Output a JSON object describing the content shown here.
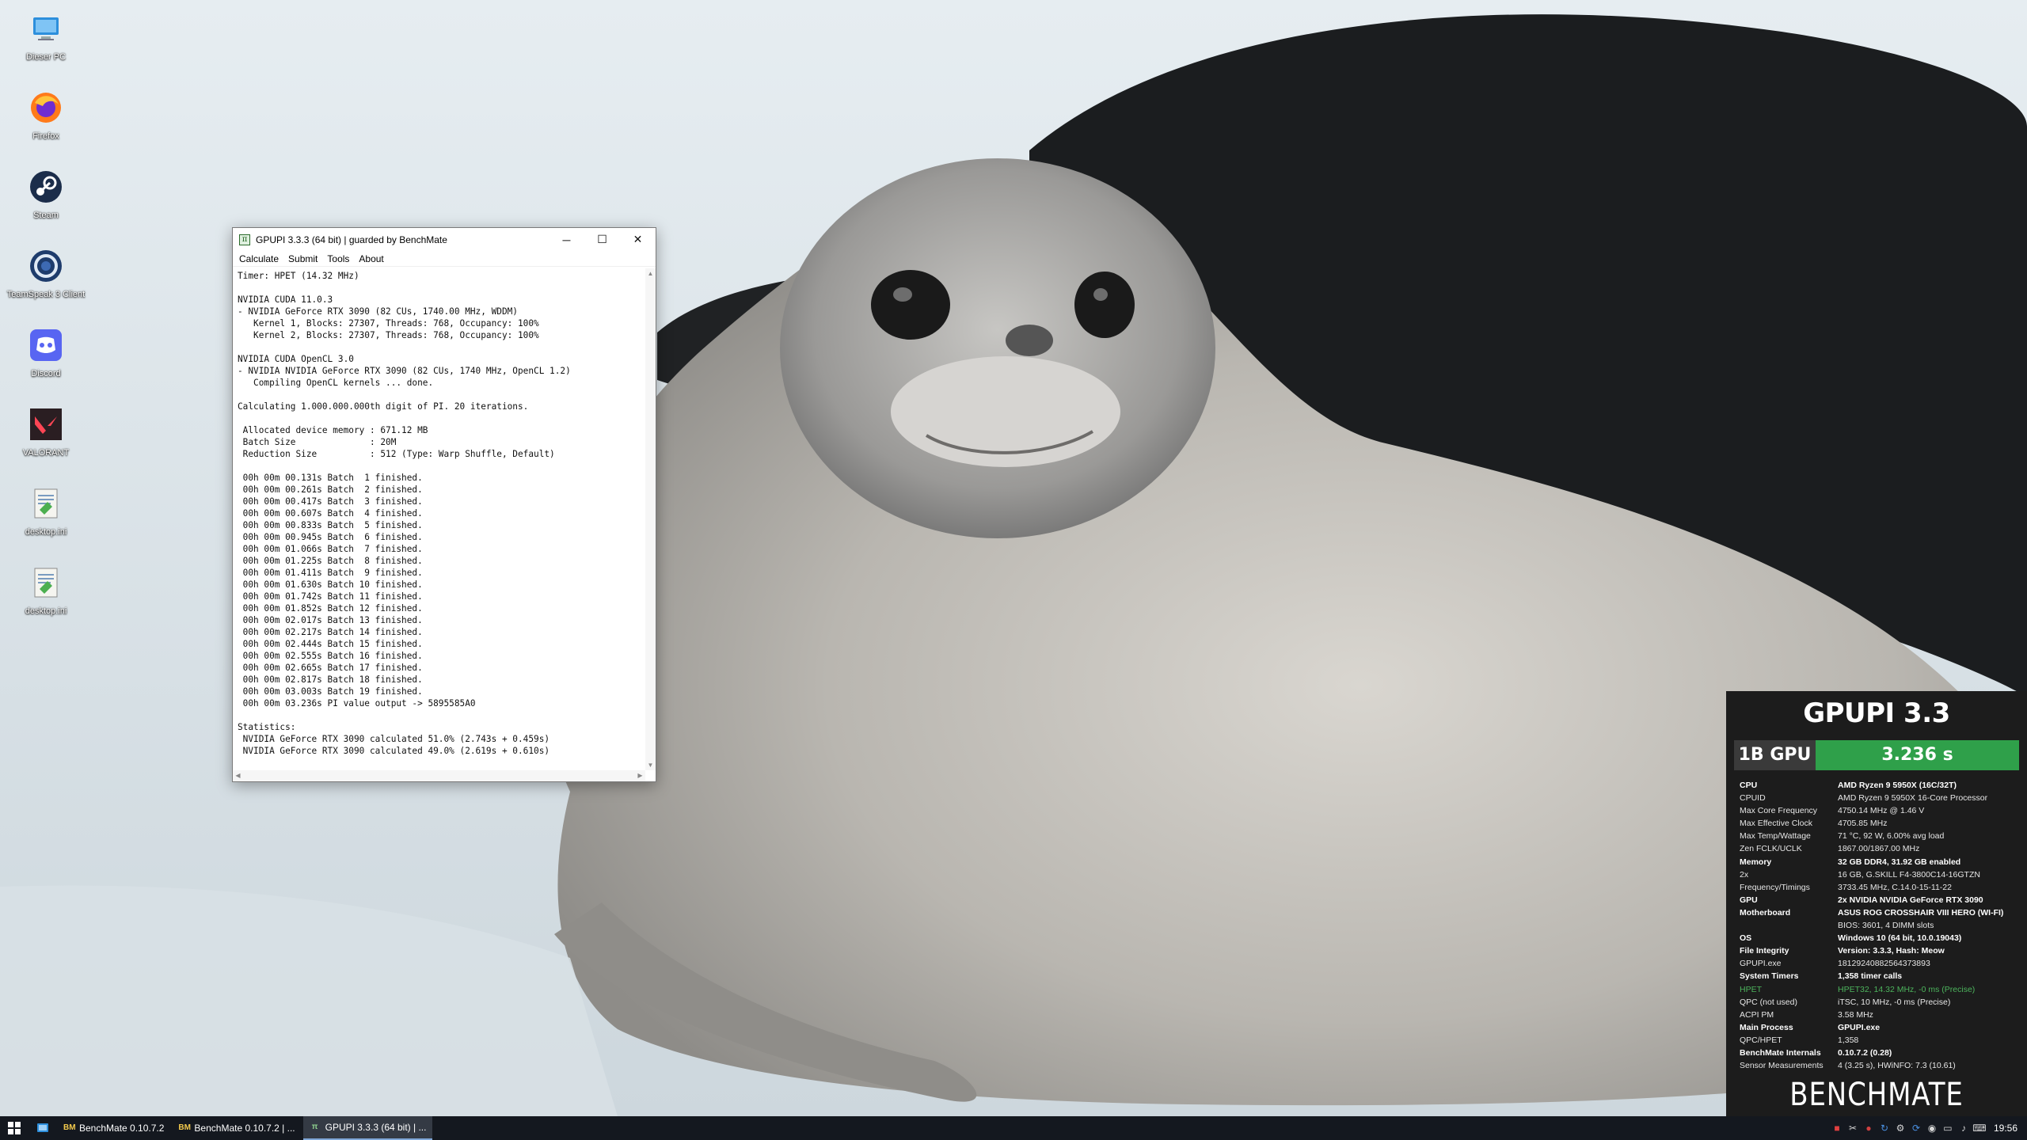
{
  "desktop": {
    "icons": [
      {
        "label": "Dieser PC",
        "icon": "computer-icon"
      },
      {
        "label": "Firefox",
        "icon": "firefox-icon"
      },
      {
        "label": "Steam",
        "icon": "steam-icon"
      },
      {
        "label": "TeamSpeak 3 Client",
        "icon": "teamspeak-icon"
      },
      {
        "label": "Discord",
        "icon": "discord-icon"
      },
      {
        "label": "VALORANT",
        "icon": "valorant-icon"
      },
      {
        "label": "desktop.ini",
        "icon": "notepad-file-icon"
      },
      {
        "label": "desktop.ini",
        "icon": "notepad-file-icon"
      }
    ]
  },
  "window": {
    "title": "GPUPI 3.3.3 (64 bit) | guarded by BenchMate",
    "controls": {
      "minimize": "─",
      "maximize": "☐",
      "close": "✕"
    },
    "menu": [
      "Calculate",
      "Submit",
      "Tools",
      "About"
    ],
    "console_lines": [
      "Timer: HPET (14.32 MHz)",
      "",
      "NVIDIA CUDA 11.0.3",
      "- NVIDIA GeForce RTX 3090 (82 CUs, 1740.00 MHz, WDDM)",
      "   Kernel 1, Blocks: 27307, Threads: 768, Occupancy: 100%",
      "   Kernel 2, Blocks: 27307, Threads: 768, Occupancy: 100%",
      "",
      "NVIDIA CUDA OpenCL 3.0",
      "- NVIDIA NVIDIA GeForce RTX 3090 (82 CUs, 1740 MHz, OpenCL 1.2)",
      "   Compiling OpenCL kernels ... done.",
      "",
      "Calculating 1.000.000.000th digit of PI. 20 iterations.",
      "",
      " Allocated device memory : 671.12 MB",
      " Batch Size              : 20M",
      " Reduction Size          : 512 (Type: Warp Shuffle, Default)",
      "",
      " 00h 00m 00.131s Batch  1 finished.",
      " 00h 00m 00.261s Batch  2 finished.",
      " 00h 00m 00.417s Batch  3 finished.",
      " 00h 00m 00.607s Batch  4 finished.",
      " 00h 00m 00.833s Batch  5 finished.",
      " 00h 00m 00.945s Batch  6 finished.",
      " 00h 00m 01.066s Batch  7 finished.",
      " 00h 00m 01.225s Batch  8 finished.",
      " 00h 00m 01.411s Batch  9 finished.",
      " 00h 00m 01.630s Batch 10 finished.",
      " 00h 00m 01.742s Batch 11 finished.",
      " 00h 00m 01.852s Batch 12 finished.",
      " 00h 00m 02.017s Batch 13 finished.",
      " 00h 00m 02.217s Batch 14 finished.",
      " 00h 00m 02.444s Batch 15 finished.",
      " 00h 00m 02.555s Batch 16 finished.",
      " 00h 00m 02.665s Batch 17 finished.",
      " 00h 00m 02.817s Batch 18 finished.",
      " 00h 00m 03.003s Batch 19 finished.",
      " 00h 00m 03.236s PI value output -> 5895585A0",
      "",
      "Statistics:",
      " NVIDIA GeForce RTX 3090 calculated 51.0% (2.743s + 0.459s)",
      " NVIDIA GeForce RTX 3090 calculated 49.0% (2.619s + 0.610s)"
    ]
  },
  "benchmate": {
    "title": "GPUPI 3.3",
    "bench_label": "1B GPU",
    "result": "3.236 s",
    "rows": [
      {
        "k": "CPU",
        "v": "AMD Ryzen 9 5950X (16C/32T)",
        "style": "bold"
      },
      {
        "k": "CPUID",
        "v": "AMD Ryzen 9 5950X 16-Core Processor",
        "style": ""
      },
      {
        "k": "Max Core Frequency",
        "v": "4750.14 MHz @ 1.46 V",
        "style": ""
      },
      {
        "k": "Max Effective Clock",
        "v": "4705.85 MHz",
        "style": ""
      },
      {
        "k": "Max Temp/Wattage",
        "v": "71 °C, 92 W, 6.00% avg load",
        "style": ""
      },
      {
        "k": "Zen FCLK/UCLK",
        "v": "1867.00/1867.00 MHz",
        "style": ""
      },
      {
        "k": "Memory",
        "v": "32 GB DDR4, 31.92 GB enabled",
        "style": "bold"
      },
      {
        "k": "2x",
        "v": "16 GB, G.SKILL F4-3800C14-16GTZN",
        "style": ""
      },
      {
        "k": "Frequency/Timings",
        "v": "3733.45 MHz, C.14.0-15-11-22",
        "style": ""
      },
      {
        "k": "GPU",
        "v": "2x NVIDIA NVIDIA GeForce RTX 3090",
        "style": "bold"
      },
      {
        "k": "Motherboard",
        "v": "ASUS ROG CROSSHAIR VIII HERO (WI-FI)",
        "style": "bold"
      },
      {
        "k": "",
        "v": "BIOS: 3601, 4 DIMM slots",
        "style": ""
      },
      {
        "k": "OS",
        "v": "Windows 10 (64 bit, 10.0.19043)",
        "style": "bold"
      },
      {
        "k": "File Integrity",
        "v": "Version: 3.3.3, Hash: Meow",
        "style": "bold"
      },
      {
        "k": "GPUPI.exe",
        "v": "18129240882564373893",
        "style": ""
      },
      {
        "k": "System Timers",
        "v": "1,358 timer calls",
        "style": "bold"
      },
      {
        "k": "HPET",
        "v": "HPET32, 14.32 MHz, -0 ms (Precise)",
        "style": "green"
      },
      {
        "k": "QPC (not used)",
        "v": "iTSC, 10 MHz, -0 ms (Precise)",
        "style": ""
      },
      {
        "k": "ACPI PM",
        "v": "3.58 MHz",
        "style": ""
      },
      {
        "k": "Main Process",
        "v": "GPUPI.exe",
        "style": "bold"
      },
      {
        "k": "QPC/HPET",
        "v": "1,358",
        "style": ""
      },
      {
        "k": "BenchMate Internals",
        "v": "0.10.7.2 (0.28)",
        "style": "bold"
      },
      {
        "k": "Sensor Measurements",
        "v": "4 (3.25 s), HWiNFO: 7.3 (10.61)",
        "style": ""
      }
    ],
    "logo": "BENCHMATE",
    "colors": {
      "result_bg": "#2fa04a",
      "panel_bg": "#1c1c1c",
      "accent_green": "#4cb35c"
    }
  },
  "taskbar": {
    "tasks": [
      {
        "label": "BenchMate 0.10.7.2",
        "icon": "benchmate-icon",
        "active": false
      },
      {
        "label": "BenchMate 0.10.7.2 | ...",
        "icon": "benchmate-icon",
        "active": false
      },
      {
        "label": "GPUPI 3.3.3 (64 bit) | ...",
        "icon": "gpupi-icon",
        "active": true
      }
    ],
    "clock": "19:56"
  }
}
